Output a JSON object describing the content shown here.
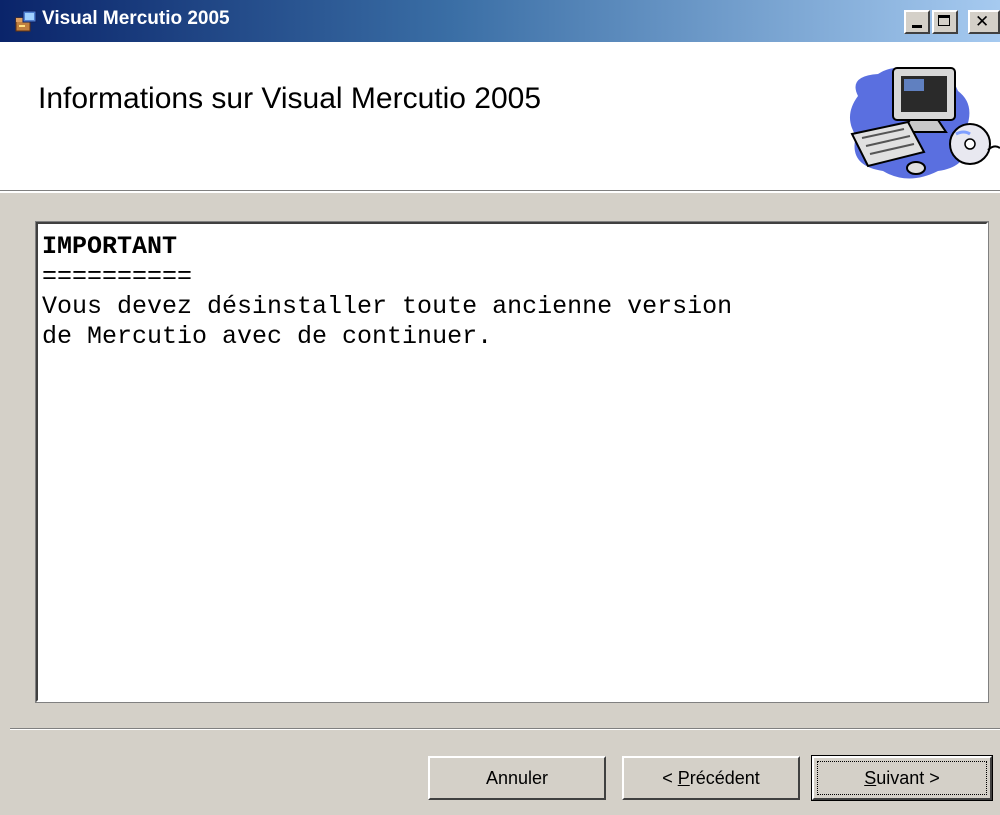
{
  "window": {
    "title": "Visual Mercutio 2005",
    "controls": {
      "minimize_icon": "minimize-icon",
      "maximize_icon": "maximize-icon",
      "close_icon": "close-icon"
    }
  },
  "header": {
    "title": "Informations sur Visual Mercutio 2005",
    "art_icon": "computer-setup-icon"
  },
  "content": {
    "line1": "IMPORTANT",
    "line2": "==========",
    "line3": "Vous devez désinstaller toute ancienne version",
    "line4": "de Mercutio avec de continuer."
  },
  "buttons": {
    "cancel": "Annuler",
    "prev_prefix": "< ",
    "prev_mnemonic": "P",
    "prev_rest": "récédent",
    "next_mnemonic": "S",
    "next_rest": "uivant >"
  },
  "colors": {
    "title_gradient_start": "#0a246a",
    "title_gradient_end": "#a6caf0",
    "face": "#d4d0c8"
  }
}
